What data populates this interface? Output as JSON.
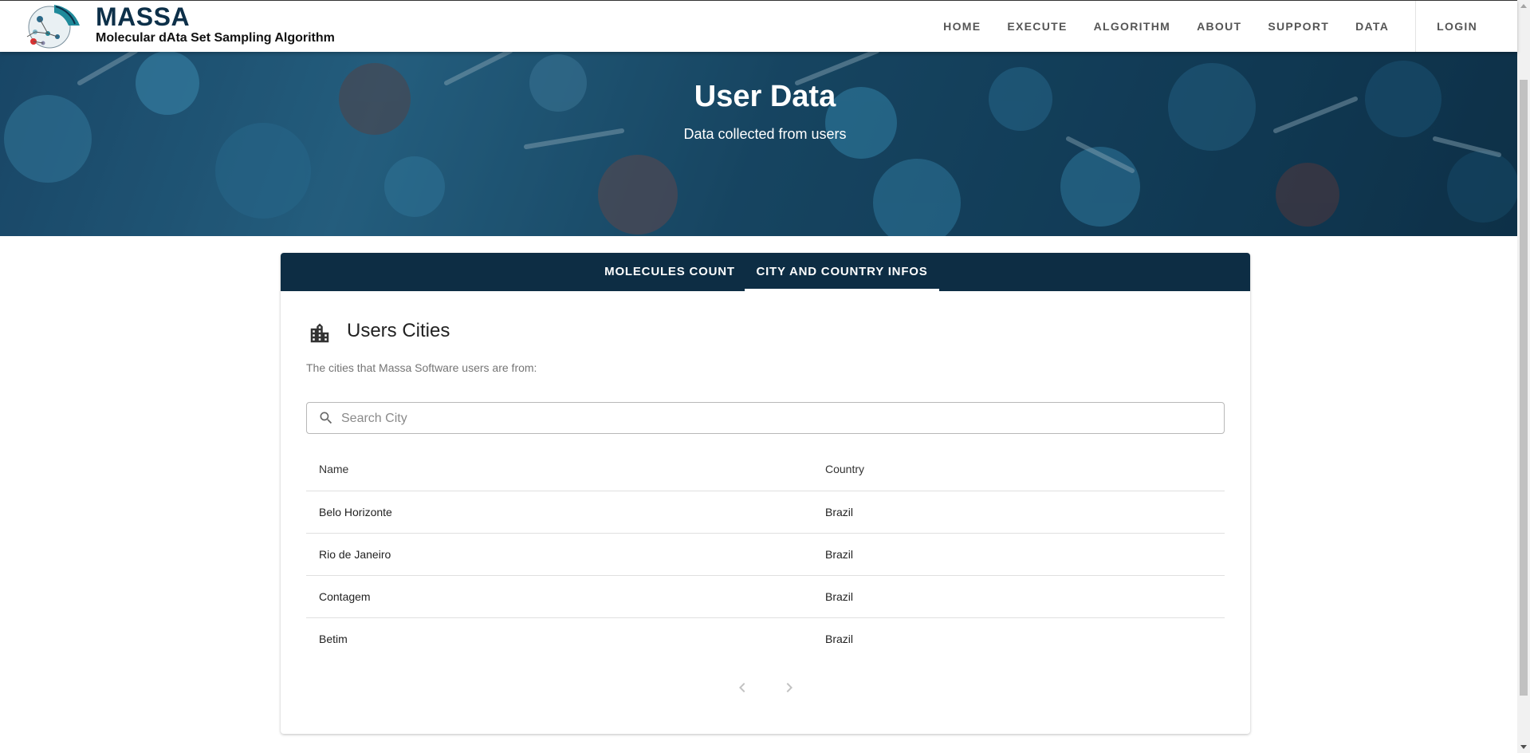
{
  "brand": {
    "title": "MASSA",
    "subtitle": "Molecular dAta Set Sampling Algorithm"
  },
  "nav": {
    "items": [
      "HOME",
      "EXECUTE",
      "ALGORITHM",
      "ABOUT",
      "SUPPORT",
      "DATA"
    ],
    "login": "LOGIN"
  },
  "hero": {
    "title": "User Data",
    "subtitle": "Data collected from users"
  },
  "tabs": [
    {
      "label": "MOLECULES COUNT",
      "active": false
    },
    {
      "label": "CITY AND COUNTRY INFOS",
      "active": true
    }
  ],
  "section": {
    "icon": "city-building-icon",
    "title": "Users Cities",
    "description": "The cities that Massa Software users are from:"
  },
  "search": {
    "placeholder": "Search City",
    "value": ""
  },
  "table": {
    "headers": [
      "Name",
      "Country"
    ],
    "rows": [
      {
        "name": "Belo Horizonte",
        "country": "Brazil"
      },
      {
        "name": "Rio de Janeiro",
        "country": "Brazil"
      },
      {
        "name": "Contagem",
        "country": "Brazil"
      },
      {
        "name": "Betim",
        "country": "Brazil"
      }
    ]
  },
  "pagination": {
    "prev_icon": "chevron-left-icon",
    "next_icon": "chevron-right-icon",
    "prev_enabled": false,
    "next_enabled": false
  },
  "colors": {
    "brand": "#0d3049",
    "tabbar": "#0d2d44",
    "hero": "#1d4f73"
  }
}
